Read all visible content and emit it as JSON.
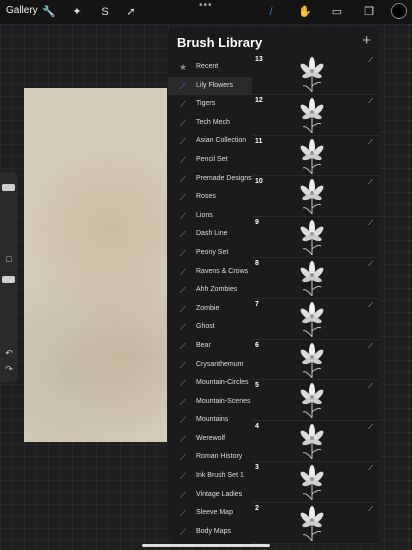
{
  "topbar": {
    "gallery_label": "Gallery",
    "more_glyph": "•••",
    "left_tools": [
      "wrench-icon",
      "magic-wand-icon",
      "selection-icon",
      "transform-arrow-icon"
    ],
    "right_tools": [
      "brush-icon",
      "smudge-icon",
      "eraser-icon",
      "layers-icon"
    ],
    "current_color": "#000000"
  },
  "sidebar": {
    "undo_glyph": "↶",
    "redo_glyph": "↷",
    "modify_glyph": "□"
  },
  "panel": {
    "title": "Brush Library",
    "add_glyph": "+",
    "sets": [
      {
        "label": "Recent",
        "icon": "star-icon",
        "active": false
      },
      {
        "label": "Lily Flowers",
        "icon": "brush-stroke-icon",
        "active": true
      },
      {
        "label": "Tigers",
        "icon": "brush-stroke-icon",
        "active": false
      },
      {
        "label": "Tech Mech",
        "icon": "brush-stroke-icon",
        "active": false
      },
      {
        "label": "Asian Collection",
        "icon": "brush-stroke-icon",
        "active": false
      },
      {
        "label": "Pencil Set",
        "icon": "brush-stroke-icon",
        "active": false
      },
      {
        "label": "Premade Designs",
        "icon": "brush-stroke-icon",
        "active": false
      },
      {
        "label": "Roses",
        "icon": "brush-stroke-icon",
        "active": false
      },
      {
        "label": "Lions",
        "icon": "brush-stroke-icon",
        "active": false
      },
      {
        "label": "Dash Line",
        "icon": "brush-stroke-icon",
        "active": false
      },
      {
        "label": "Peony Set",
        "icon": "brush-stroke-icon",
        "active": false
      },
      {
        "label": "Ravens & Crows",
        "icon": "brush-stroke-icon",
        "active": false
      },
      {
        "label": "Ahh Zombies",
        "icon": "brush-stroke-icon",
        "active": false
      },
      {
        "label": "Zombie",
        "icon": "brush-stroke-icon",
        "active": false
      },
      {
        "label": "Ghost",
        "icon": "brush-stroke-icon",
        "active": false
      },
      {
        "label": "Bear",
        "icon": "brush-stroke-icon",
        "active": false
      },
      {
        "label": "Crysanthemum",
        "icon": "brush-stroke-icon",
        "active": false
      },
      {
        "label": "Mountain-Circles",
        "icon": "brush-stroke-icon",
        "active": false
      },
      {
        "label": "Mountain-Scenes",
        "icon": "brush-stroke-icon",
        "active": false
      },
      {
        "label": "Mountains",
        "icon": "brush-stroke-icon",
        "active": false
      },
      {
        "label": "Werewolf",
        "icon": "brush-stroke-icon",
        "active": false
      },
      {
        "label": "Roman History",
        "icon": "brush-stroke-icon",
        "active": false
      },
      {
        "label": "Ink Brush Set 1",
        "icon": "brush-stroke-icon",
        "active": false
      },
      {
        "label": "Vintage Ladies",
        "icon": "brush-stroke-icon",
        "active": false
      },
      {
        "label": "Sleeve Map",
        "icon": "brush-stroke-icon",
        "active": false
      },
      {
        "label": "Body Maps",
        "icon": "brush-stroke-icon",
        "active": false
      }
    ],
    "brushes": [
      {
        "number": "13"
      },
      {
        "number": "12"
      },
      {
        "number": "11"
      },
      {
        "number": "10"
      },
      {
        "number": "9"
      },
      {
        "number": "8"
      },
      {
        "number": "7"
      },
      {
        "number": "6"
      },
      {
        "number": "5"
      },
      {
        "number": "4"
      },
      {
        "number": "3"
      },
      {
        "number": "2"
      }
    ]
  }
}
